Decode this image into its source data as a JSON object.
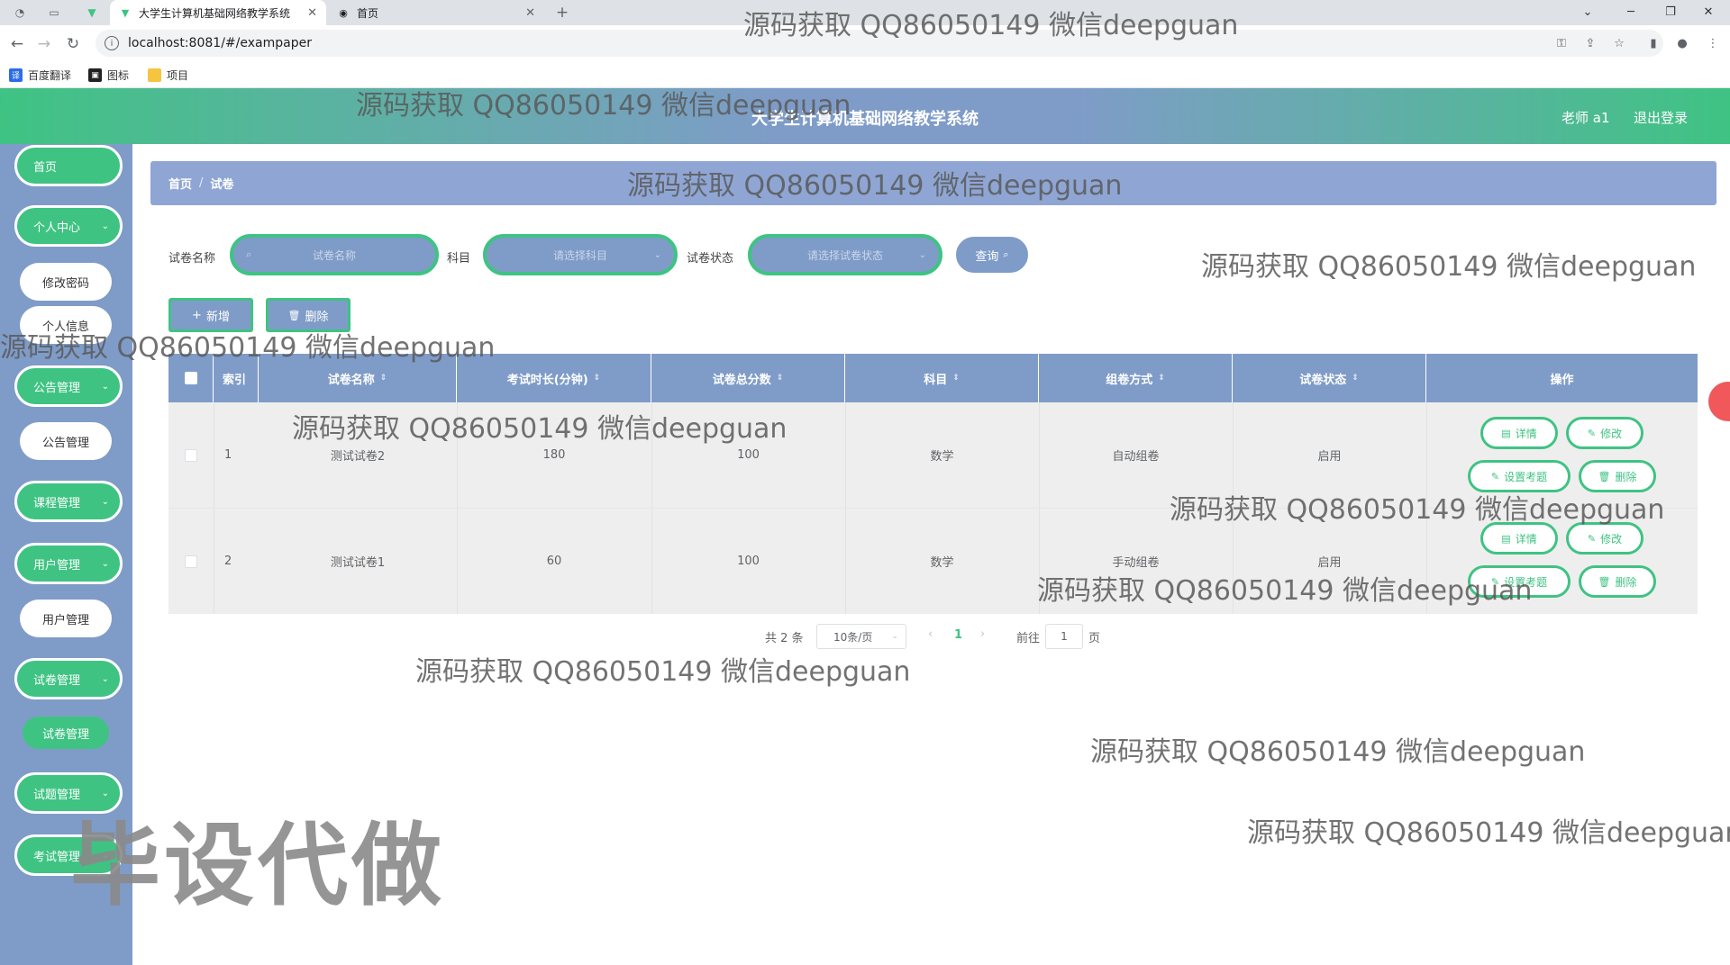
{
  "browser": {
    "tabs": [
      {
        "title": "大学生计算机基础网络教学系统",
        "active": true
      },
      {
        "title": "首页",
        "active": false
      }
    ],
    "new_tab": "+",
    "url": "localhost:8081/#/exampaper",
    "bookmarks": [
      "百度翻译",
      "图标",
      "项目"
    ]
  },
  "header": {
    "title": "大学生计算机基础网络教学系统",
    "user": "老师 a1",
    "logout": "退出登录"
  },
  "sidebar": {
    "menus": [
      {
        "label": "首页",
        "expandable": false
      },
      {
        "label": "个人中心",
        "expandable": true,
        "children": [
          "修改密码",
          "个人信息"
        ]
      },
      {
        "label": "公告管理",
        "expandable": true,
        "children": [
          "公告管理"
        ]
      },
      {
        "label": "课程管理",
        "expandable": true
      },
      {
        "label": "用户管理",
        "expandable": true,
        "children": [
          "用户管理"
        ]
      },
      {
        "label": "试卷管理",
        "expandable": true,
        "children": [
          "试卷管理"
        ]
      },
      {
        "label": "试题管理",
        "expandable": true
      },
      {
        "label": "考试管理",
        "expandable": true
      }
    ]
  },
  "breadcrumb": {
    "home": "首页",
    "sep": "/",
    "current": "试卷"
  },
  "search": {
    "name_label": "试卷名称",
    "name_placeholder": "试卷名称",
    "subject_label": "科目",
    "subject_placeholder": "请选择科目",
    "status_label": "试卷状态",
    "status_placeholder": "请选择试卷状态",
    "query_button": "查询"
  },
  "actions": {
    "add": "新增",
    "delete": "删除"
  },
  "table": {
    "columns": [
      "索引",
      "试卷名称",
      "考试时长(分钟)",
      "试卷总分数",
      "科目",
      "组卷方式",
      "试卷状态",
      "操作"
    ],
    "rows": [
      {
        "index": "1",
        "name": "测试试卷2",
        "duration": "180",
        "total": "100",
        "subject": "数学",
        "mode": "自动组卷",
        "status": "启用"
      },
      {
        "index": "2",
        "name": "测试试卷1",
        "duration": "60",
        "total": "100",
        "subject": "数学",
        "mode": "手动组卷",
        "status": "启用"
      }
    ],
    "row_actions": {
      "detail": "详情",
      "edit": "修改",
      "set_questions": "设置考题",
      "delete": "删除"
    }
  },
  "pagination": {
    "total": "共 2 条",
    "page_size": "10条/页",
    "current": "1",
    "goto": "前往",
    "goto_value": "1",
    "page_suffix": "页"
  },
  "watermarks": {
    "text": "源码获取 QQ86050149 微信deepguan",
    "big": "毕设代做"
  },
  "colors": {
    "green": "#3fc383",
    "blue": "#7f9cc8",
    "breadcrumb": "#8fa6d4"
  }
}
